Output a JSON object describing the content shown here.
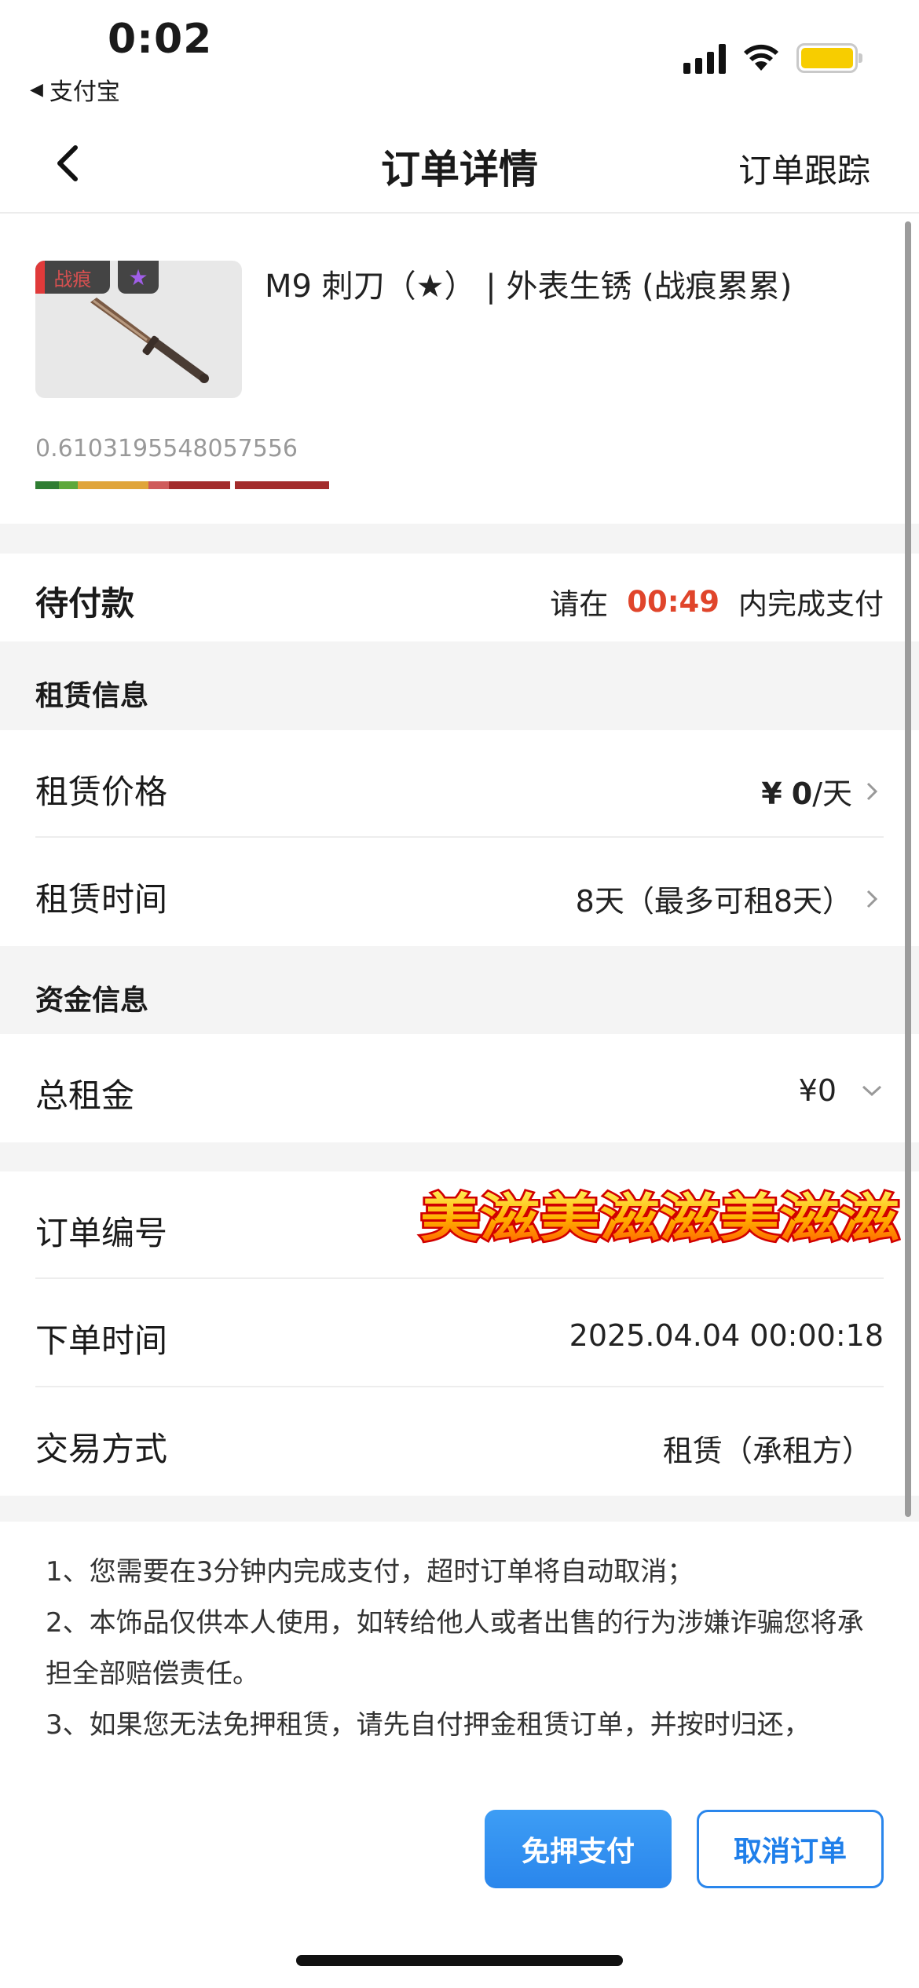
{
  "status_bar": {
    "time": "0:02",
    "back_app": "支付宝",
    "back_app_icon": "back-triangle-icon",
    "battery_color": "#f7cd00"
  },
  "nav": {
    "title": "订单详情",
    "right_action": "订单跟踪",
    "back_icon": "chevron-left-icon"
  },
  "product": {
    "tag_wear": "战痕",
    "tag_star": "★",
    "name": "M9 刺刀（★） | 外表生锈 (战痕累累)",
    "float_value": "0.6103195548057556"
  },
  "payment_status": {
    "label": "待付款",
    "prefix": "请在",
    "countdown": "00:49",
    "suffix": "内完成支付",
    "countdown_color": "#e0452b"
  },
  "rental_section": {
    "heading": "租赁信息",
    "price_label": "租赁价格",
    "price_currency": "¥",
    "price_value": "0",
    "price_unit": "/天",
    "duration_label": "租赁时间",
    "duration_value": "8天（最多可租8天）"
  },
  "funds_section": {
    "heading": "资金信息",
    "total_label": "总租金",
    "total_value": "¥0"
  },
  "order_info": {
    "number_label": "订单编号",
    "sticker_text": "美滋美滋滋美滋滋",
    "time_label": "下单时间",
    "time_value": "2025.04.04 00:00:18",
    "method_label": "交易方式",
    "method_value": "租赁（承租方）"
  },
  "notes": [
    "1、您需要在3分钟内完成支付，超时订单将自动取消；",
    "2、本饰品仅供本人使用，如转给他人或者出售的行为涉嫌诈骗您将承担全部赔偿责任。",
    "3、如果您无法免押租赁，请先自付押金租赁订单，并按时归还，"
  ],
  "actions": {
    "pay_label": "免押支付",
    "cancel_label": "取消订单",
    "accent_color": "#2a86ec"
  }
}
